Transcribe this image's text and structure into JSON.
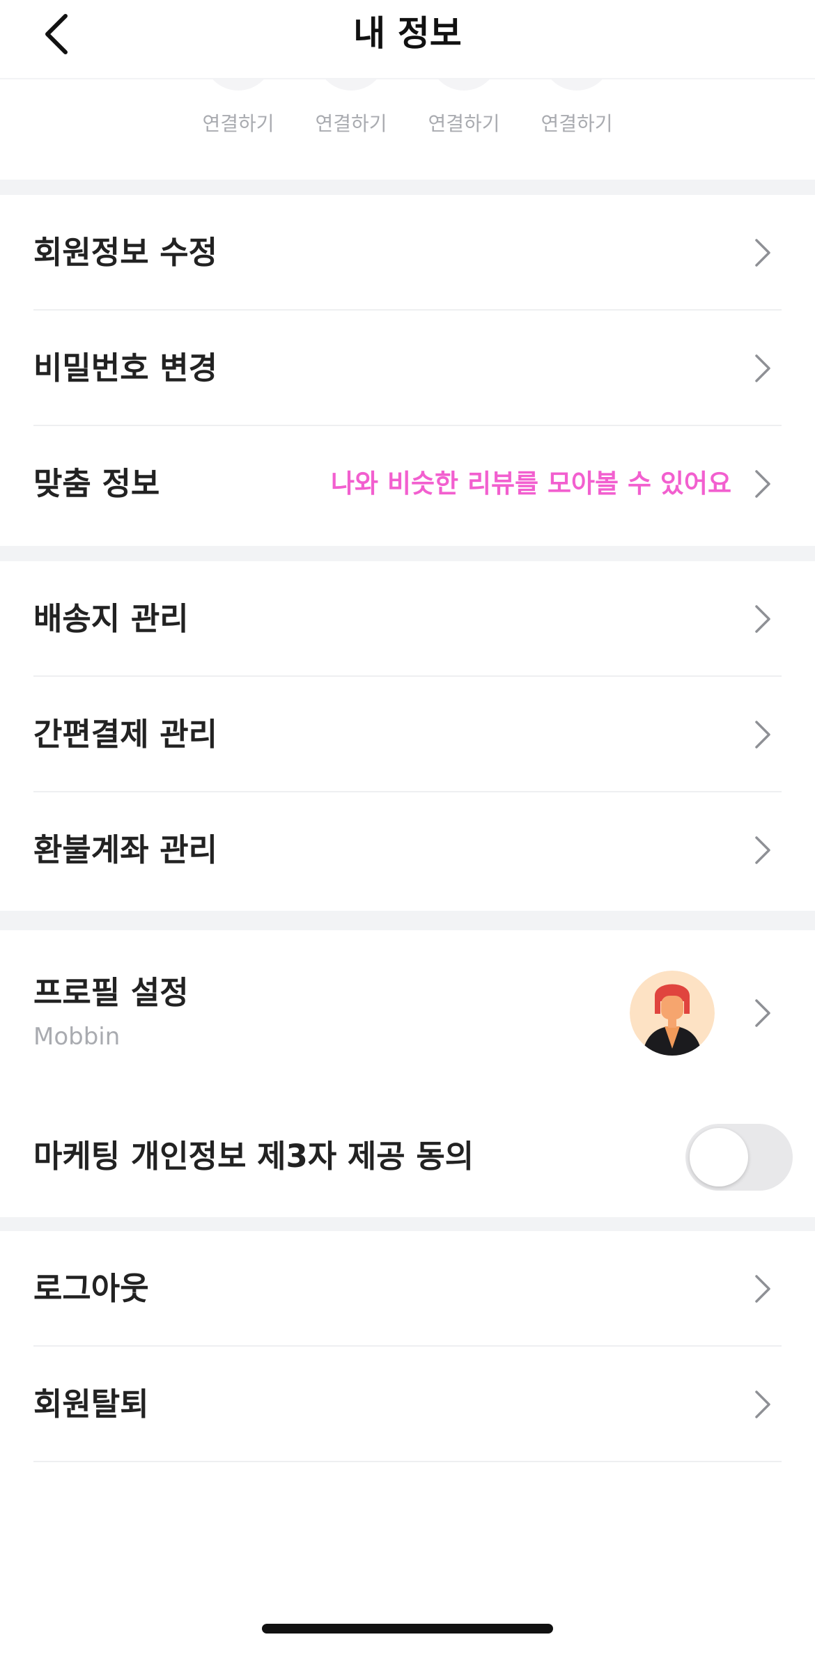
{
  "header": {
    "title": "내 정보"
  },
  "social": {
    "items": [
      {
        "label": "연결하기"
      },
      {
        "label": "연결하기"
      },
      {
        "label": "연결하기"
      },
      {
        "label": "연결하기"
      }
    ]
  },
  "account": {
    "edit_member": "회원정보 수정",
    "change_password": "비밀번호 변경",
    "custom_info": "맞춤 정보",
    "custom_info_hint": "나와 비슷한 리뷰를 모아볼 수 있어요"
  },
  "manage": {
    "shipping": "배송지 관리",
    "easy_pay": "간편결제 관리",
    "refund_account": "환불계좌 관리"
  },
  "profile": {
    "label": "프로필 설정",
    "username": "Mobbin"
  },
  "marketing": {
    "label": "마케팅 개인정보 제3자 제공 동의",
    "enabled": false
  },
  "footer_menu": {
    "logout": "로그아웃",
    "withdraw": "회원탈퇴"
  },
  "colors": {
    "accent_pink": "#f25fcf",
    "separator": "#f2f3f5",
    "muted_text": "#a9abb0"
  }
}
